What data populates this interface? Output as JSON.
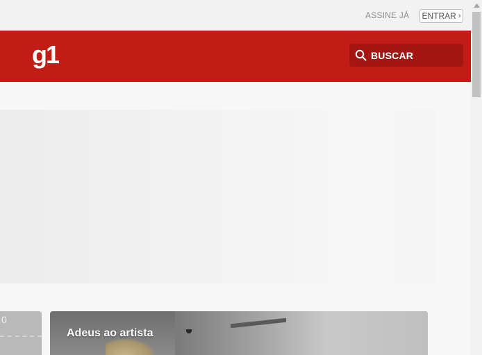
{
  "topbar": {
    "subscribe_label": "ASSINE JÁ",
    "login_label": "ENTRAR",
    "login_icon": "chevron-right-icon"
  },
  "header": {
    "logo_text": "g1",
    "search_label": "BUSCAR",
    "search_icon": "search-icon",
    "brand_color": "#c21c17",
    "search_bg_color": "#a51612"
  },
  "ad_slot": {},
  "cards": {
    "left_partial_value": "0",
    "main_title": "Adeus ao artista"
  },
  "scrollbar": {
    "up_icon": "scroll-up-arrow-icon"
  }
}
